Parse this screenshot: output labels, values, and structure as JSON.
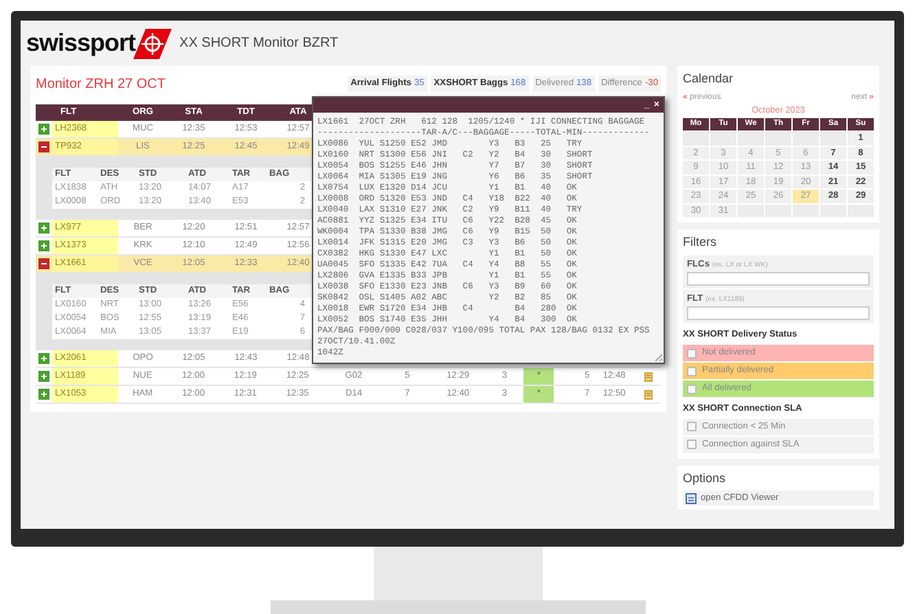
{
  "header": {
    "logo": "swissport",
    "title": "XX SHORT Monitor BZRT"
  },
  "monitor": {
    "title": "Monitor ZRH 27 OCT",
    "stats": [
      {
        "label": "Arrival Flights",
        "value": "35",
        "emphasis": true,
        "color": "#5b73d6"
      },
      {
        "label": "XXSHORT Baggs",
        "value": "168",
        "emphasis": true,
        "color": "#5b73d6"
      },
      {
        "label": "Delivered",
        "value": "138",
        "emphasis": false,
        "color": "#5b73d6"
      },
      {
        "label": "Difference",
        "value": "-30",
        "emphasis": false,
        "color": "#e0504a"
      }
    ]
  },
  "table": {
    "columns": [
      "FLT",
      "ORG",
      "STA",
      "TDT",
      "ATA"
    ],
    "rows": [
      {
        "flt": "LH2368",
        "org": "MUC",
        "sta": "12:35",
        "tdt": "12:53",
        "ata": "12:57",
        "expanded": false
      },
      {
        "flt": "TP932",
        "org": "LIS",
        "sta": "12:25",
        "tdt": "12:45",
        "ata": "12:49",
        "expanded": true,
        "details": {
          "columns": [
            "FLT",
            "DES",
            "STD",
            "ATD",
            "TAR",
            "BAG"
          ],
          "rows": [
            [
              "LX1838",
              "ATH",
              "13:20",
              "14:07",
              "A17",
              "2"
            ],
            [
              "LX0008",
              "ORD",
              "13:20",
              "13:40",
              "E53",
              "2"
            ]
          ]
        }
      },
      {
        "flt": "LX977",
        "org": "BER",
        "sta": "12:20",
        "tdt": "12:51",
        "ata": "12:57",
        "expanded": false
      },
      {
        "flt": "LX1373",
        "org": "KRK",
        "sta": "12:10",
        "tdt": "12:49",
        "ata": "12:56",
        "expanded": false
      },
      {
        "flt": "LX1661",
        "org": "VCE",
        "sta": "12:05",
        "tdt": "12:33",
        "ata": "12:40",
        "expanded": true,
        "details": {
          "columns": [
            "FLT",
            "DES",
            "STD",
            "ATD",
            "TAR",
            "BAG"
          ],
          "rows": [
            [
              "LX0160",
              "NRT",
              "13:00",
              "13:26",
              "E56",
              "4"
            ],
            [
              "LX0054",
              "BOS",
              "12:55",
              "13:19",
              "E46",
              "7"
            ],
            [
              "LX0064",
              "MIA",
              "13:05",
              "13:37",
              "E19",
              "6"
            ]
          ]
        }
      },
      {
        "flt": "LX2061",
        "org": "OPO",
        "sta": "12:05",
        "tdt": "12:43",
        "ata": "12:48",
        "expanded": false
      },
      {
        "flt": "LX1189",
        "org": "NUE",
        "sta": "12:00",
        "tdt": "12:19",
        "ata": "12:25",
        "expanded": false,
        "more": [
          "G02",
          "5",
          "12:29",
          "3"
        ],
        "mark": "*",
        "tail": [
          "5",
          "12:48"
        ],
        "note_icon": true
      },
      {
        "flt": "LX1053",
        "org": "HAM",
        "sta": "12:00",
        "tdt": "12:31",
        "ata": "12:35",
        "expanded": false,
        "more": [
          "D14",
          "7",
          "12:40",
          "3"
        ],
        "mark": "*",
        "tail": [
          "7",
          "12:50"
        ],
        "note_icon": true
      }
    ]
  },
  "popup": {
    "minimize": "_",
    "close": "×",
    "lines": [
      "LX1661  27OCT ZRH   612 128  1205/1240 * IJI CONNECTING BAGGAGE",
      "--------------------TAR-A/C---BAGGAGE-----TOTAL-MIN-------------",
      "LX0086  YUL S1250 E52 JMD        Y3   B3   25   TRY",
      "LX0160  NRT S1300 E56 JNI   C2   Y2   B4   30   SHORT",
      "LX0054  BOS S1255 E46 JHN        Y7   B7   30   SHORT",
      "LX0064  MIA S1305 E19 JNG        Y6   B6   35   SHORT",
      "LX0754  LUX E1320 D14 JCU        Y1   B1   40   OK",
      "LX0008  ORD S1320 E53 JND   C4   Y18  B22  40   OK",
      "LX0040  LAX S1310 E27 JNK   C2   Y9   B11  40   TRY",
      "AC0881  YYZ S1325 E34 ITU   C6   Y22  B28  45   OK",
      "WK0004  TPA S1330 B38 JMG   C6   Y9   B15  50   OK",
      "LX0014  JFK S1315 E20 JMG   C3   Y3   B6   50   OK",
      "CX0382  HKG S1330 E47 LXC        Y1   B1   50   OK",
      "UA0045  SFO S1335 E42 7UA   C4   Y4   B8   55   OK",
      "LX2806  GVA E1335 B33 JPB        Y1   B1   55   OK",
      "LX0038  SFO E1330 E23 JNB   C6   Y3   B9   60   OK",
      "SK0842  OSL S1405 A02 ABC        Y2   B2   85   OK",
      "LX0018  EWR S1720 E34 JHB   C4        B4   280  OK",
      "LX0052  BOS S1740 E35 JHH        Y4   B4   300  OK",
      "PAX/BAG F000/000 C028/037 Y100/095 TOTAL PAX 128/BAG 0132 EX PSS",
      "27OCT/10.41.00Z",
      "1042Z"
    ]
  },
  "calendar": {
    "title": "Calendar",
    "previous": "previous",
    "previous_glyph": "«",
    "next": "next",
    "next_glyph": "»",
    "month": "October 2023",
    "weekdays": [
      "Mo",
      "Tu",
      "We",
      "Th",
      "Fr",
      "Sa",
      "Su"
    ],
    "weeks": [
      [
        {
          "kind": "empty"
        },
        {
          "kind": "empty"
        },
        {
          "kind": "empty"
        },
        {
          "kind": "empty"
        },
        {
          "kind": "empty"
        },
        {
          "kind": "empty"
        },
        {
          "kind": "day",
          "label": "1",
          "selected": false
        }
      ],
      [
        {
          "kind": "day",
          "label": "2",
          "selected": false
        },
        {
          "kind": "day",
          "label": "3",
          "selected": false
        },
        {
          "kind": "day",
          "label": "4",
          "selected": false
        },
        {
          "kind": "day",
          "label": "5",
          "selected": false
        },
        {
          "kind": "day",
          "label": "6",
          "selected": false
        },
        {
          "kind": "day",
          "label": "7",
          "selected": false
        },
        {
          "kind": "day",
          "label": "8",
          "selected": false
        }
      ],
      [
        {
          "kind": "day",
          "label": "9",
          "selected": false
        },
        {
          "kind": "day",
          "label": "10",
          "selected": false
        },
        {
          "kind": "day",
          "label": "11",
          "selected": false
        },
        {
          "kind": "day",
          "label": "12",
          "selected": false
        },
        {
          "kind": "day",
          "label": "13",
          "selected": false
        },
        {
          "kind": "day",
          "label": "14",
          "selected": false
        },
        {
          "kind": "day",
          "label": "15",
          "selected": false
        }
      ],
      [
        {
          "kind": "day",
          "label": "16",
          "selected": false
        },
        {
          "kind": "day",
          "label": "17",
          "selected": false
        },
        {
          "kind": "day",
          "label": "18",
          "selected": false
        },
        {
          "kind": "day",
          "label": "19",
          "selected": false
        },
        {
          "kind": "day",
          "label": "20",
          "selected": false
        },
        {
          "kind": "day",
          "label": "21",
          "selected": false
        },
        {
          "kind": "day",
          "label": "22",
          "selected": false
        }
      ],
      [
        {
          "kind": "day",
          "label": "23",
          "selected": false
        },
        {
          "kind": "day",
          "label": "24",
          "selected": false
        },
        {
          "kind": "day",
          "label": "25",
          "selected": false
        },
        {
          "kind": "day",
          "label": "26",
          "selected": false
        },
        {
          "kind": "day",
          "label": "27",
          "selected": true
        },
        {
          "kind": "day",
          "label": "28",
          "selected": false
        },
        {
          "kind": "day",
          "label": "29",
          "selected": false
        }
      ],
      [
        {
          "kind": "day",
          "label": "30",
          "selected": false
        },
        {
          "kind": "day",
          "label": "31",
          "selected": false
        },
        {
          "kind": "empty"
        },
        {
          "kind": "empty"
        },
        {
          "kind": "empty"
        },
        {
          "kind": "empty"
        },
        {
          "kind": "empty"
        }
      ]
    ]
  },
  "filters": {
    "title": "Filters",
    "fields": [
      {
        "label": "FLCs",
        "hint": "(ex. LX or LX WK)"
      },
      {
        "label": "FLT",
        "hint": "(ex. LX1189)"
      }
    ],
    "delivery": {
      "title": "XX SHORT Delivery Status",
      "items": [
        {
          "label": "Not delivered",
          "checked": false,
          "color": "#ffb3b3"
        },
        {
          "label": "Partially delivered",
          "checked": false,
          "color": "#ffcb6b"
        },
        {
          "label": "All delivered",
          "checked": false,
          "color": "#b2e27a"
        }
      ]
    },
    "sla": {
      "title": "XX SHORT Connection SLA",
      "items": [
        {
          "label": "Connection < 25 Min",
          "checked": false
        },
        {
          "label": "Connection against SLA",
          "checked": false
        }
      ]
    }
  },
  "options": {
    "title": "Options",
    "items": [
      "open CFDD Viewer"
    ]
  }
}
